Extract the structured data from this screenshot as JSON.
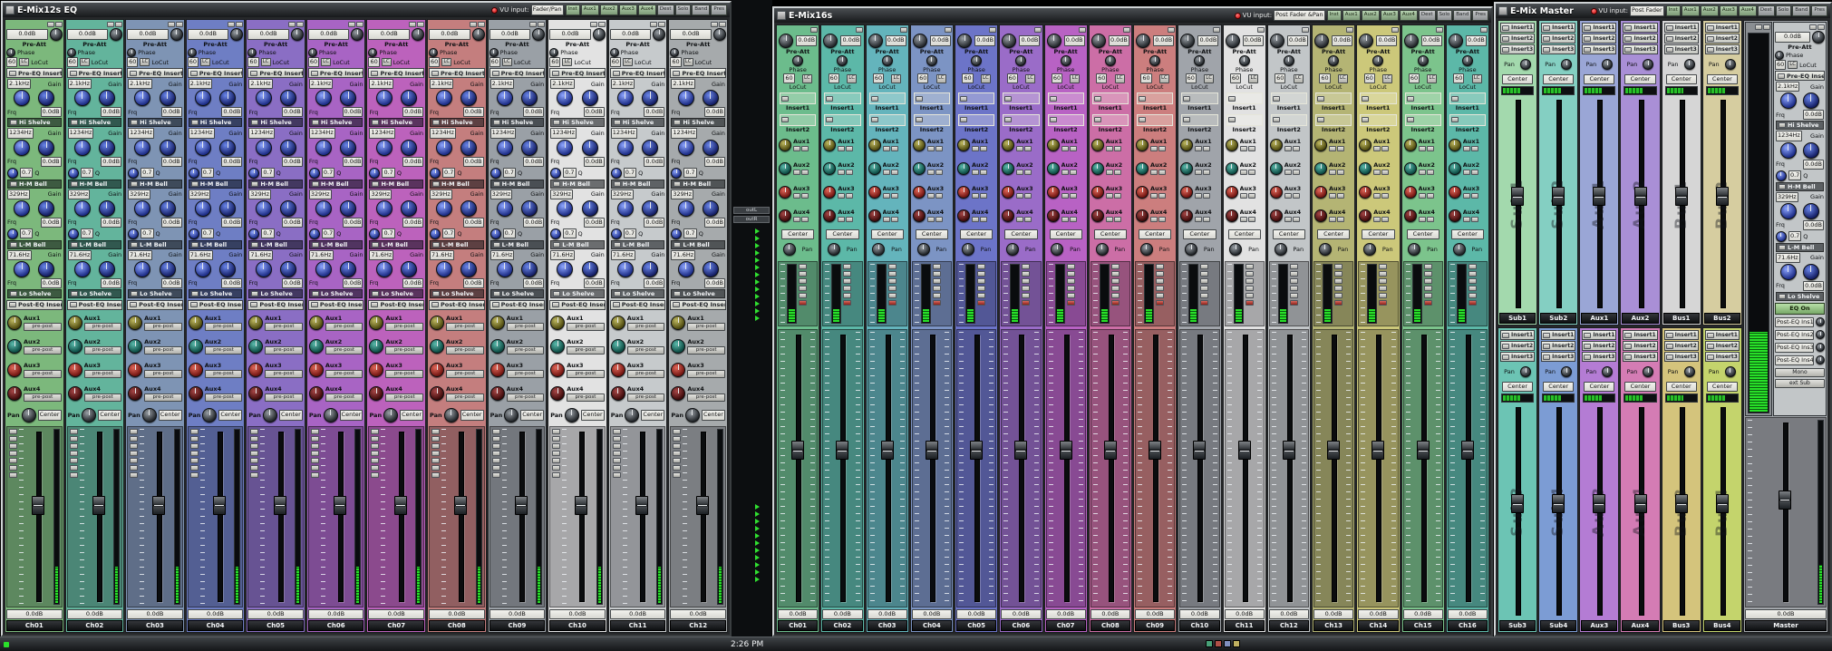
{
  "taskbar": {
    "time": "2:26 PM"
  },
  "shared": {
    "vu_input_label": "VU input:",
    "header_buttons": [
      "Inst",
      "Aux1",
      "Aux2",
      "Aux3",
      "Aux4",
      "Dest",
      "Solo",
      "Band",
      "Pres"
    ]
  },
  "eq_window": {
    "title": "E-Mix12s EQ",
    "vu_value": "Fader/Pan",
    "strip": {
      "pre_att_value": "0.0dB",
      "pre_att_label": "Pre-Att",
      "phase_label": "Phase",
      "locut_value": "60",
      "locut_button": "LC",
      "locut_label": "LoCut",
      "pre_eq_insert": "Pre-EQ Insert",
      "freq_label": "Frq",
      "gain_label": "Gain",
      "q_label": "Q",
      "bands": [
        {
          "name": "Hi Shelve",
          "freq": "2.1kHz",
          "gain": "0.0dB"
        },
        {
          "name": "H-M Bell",
          "freq": "1234Hz",
          "gain": "0.0dB",
          "q": "0.7"
        },
        {
          "name": "L-M Bell",
          "freq": "329Hz",
          "gain": "0.0dB",
          "q": "0.7"
        },
        {
          "name": "Lo Shelve",
          "freq": "71.6Hz",
          "gain": "0.0dB"
        }
      ],
      "post_eq_insert": "Post-EQ Insert",
      "auxes": [
        {
          "label": "Aux1",
          "button": "pre-post",
          "knob": "kb-olive"
        },
        {
          "label": "Aux2",
          "button": "pre-post",
          "knob": "kb-teal"
        },
        {
          "label": "Aux3",
          "button": "pre-post",
          "knob": "kb-red"
        },
        {
          "label": "Aux4",
          "button": "pre-post",
          "knob": "kb-maroon"
        }
      ],
      "pan_label": "Pan",
      "pan_value": "Center",
      "fader_value": "0.0dB"
    },
    "channels": [
      {
        "name": "Ch01",
        "color": "#7cb87c"
      },
      {
        "name": "Ch02",
        "color": "#63b49c"
      },
      {
        "name": "Ch03",
        "color": "#7e94b4"
      },
      {
        "name": "Ch04",
        "color": "#6e7ec4"
      },
      {
        "name": "Ch05",
        "color": "#8a6ec4"
      },
      {
        "name": "Ch06",
        "color": "#a864c4"
      },
      {
        "name": "Ch07",
        "color": "#bc62bc"
      },
      {
        "name": "Ch08",
        "color": "#c47e7e"
      },
      {
        "name": "Ch09",
        "color": "#9aa0a6"
      },
      {
        "name": "Ch10",
        "color": "#e2e2e2"
      },
      {
        "name": "Ch11",
        "color": "#c6cacc"
      },
      {
        "name": "Ch12",
        "color": "#a6aaac"
      }
    ]
  },
  "mix_window": {
    "title": "E-Mix16s",
    "vu_value": "Post Fader &Pan",
    "strip": {
      "pre_att_value": "0.0dB",
      "pre_att_label": "Pre-Att",
      "phase_label": "Phase",
      "locut_value": "60",
      "locut_button": "LC",
      "locut_label": "LoCut",
      "inserts": [
        "Insert1",
        "Insert2"
      ],
      "auxes": [
        {
          "label": "Aux1",
          "knob": "kb-olive"
        },
        {
          "label": "Aux2",
          "knob": "kb-teal"
        },
        {
          "label": "Aux3",
          "knob": "kb-red"
        },
        {
          "label": "Aux4",
          "knob": "kb-maroon"
        }
      ],
      "pan_label": "Pan",
      "pan_value": "Center",
      "fader_value": "0.0dB"
    },
    "channels": [
      {
        "name": "Ch01",
        "color": "#6cbc8c"
      },
      {
        "name": "Ch02",
        "color": "#5cb8a8"
      },
      {
        "name": "Ch03",
        "color": "#64b4bc"
      },
      {
        "name": "Ch04",
        "color": "#7c94c4"
      },
      {
        "name": "Ch05",
        "color": "#6c74c8"
      },
      {
        "name": "Ch06",
        "color": "#9a6cc8"
      },
      {
        "name": "Ch07",
        "color": "#b862c4"
      },
      {
        "name": "Ch08",
        "color": "#cc6ea6"
      },
      {
        "name": "Ch09",
        "color": "#cc7e7e"
      },
      {
        "name": "Ch10",
        "color": "#a0a4aa"
      },
      {
        "name": "Ch11",
        "color": "#e2e2e2"
      },
      {
        "name": "Ch12",
        "color": "#c2c6c8"
      },
      {
        "name": "Ch13",
        "color": "#b4b474"
      },
      {
        "name": "Ch14",
        "color": "#ccc87a"
      },
      {
        "name": "Ch15",
        "color": "#7cc48c"
      },
      {
        "name": "Ch16",
        "color": "#5cb8a8"
      }
    ]
  },
  "master_window": {
    "title": "E-Mix Master",
    "vu_value": "Post Fader",
    "strip": {
      "inserts": [
        "Insert1",
        "Insert2",
        "Insert3"
      ],
      "pan_label": "Pan",
      "pan_value": "Center"
    },
    "top_channels": [
      {
        "name": "Sub1",
        "color": "#a3d9ad"
      },
      {
        "name": "Sub2",
        "color": "#84cfc2"
      },
      {
        "name": "Aux1",
        "color": "#9aa6d6"
      },
      {
        "name": "Aux2",
        "color": "#a98fd6"
      },
      {
        "name": "Bus1",
        "color": "#d6d6d6"
      },
      {
        "name": "Bus2",
        "color": "#d6cda0"
      }
    ],
    "bottom_channels": [
      {
        "name": "Sub3",
        "color": "#6cc4b4"
      },
      {
        "name": "Sub4",
        "color": "#7c9cd4"
      },
      {
        "name": "Aux3",
        "color": "#b47cd4"
      },
      {
        "name": "Aux4",
        "color": "#d47cb4"
      },
      {
        "name": "Bus3",
        "color": "#d4c47c"
      },
      {
        "name": "Bus4",
        "color": "#c4d46c"
      }
    ],
    "master": {
      "name": "Master",
      "eq_on": "EQ On",
      "post_rows": [
        "Post-EQ Ins1",
        "Post-EQ Ins2",
        "Post-EQ Ins3",
        "Post-EQ Ins4"
      ],
      "mono": "Mono",
      "ext_sub": "ext Sub",
      "fader_value": "0.0dB"
    }
  },
  "background_panel": {
    "labels": [
      "outL",
      "outR"
    ]
  }
}
